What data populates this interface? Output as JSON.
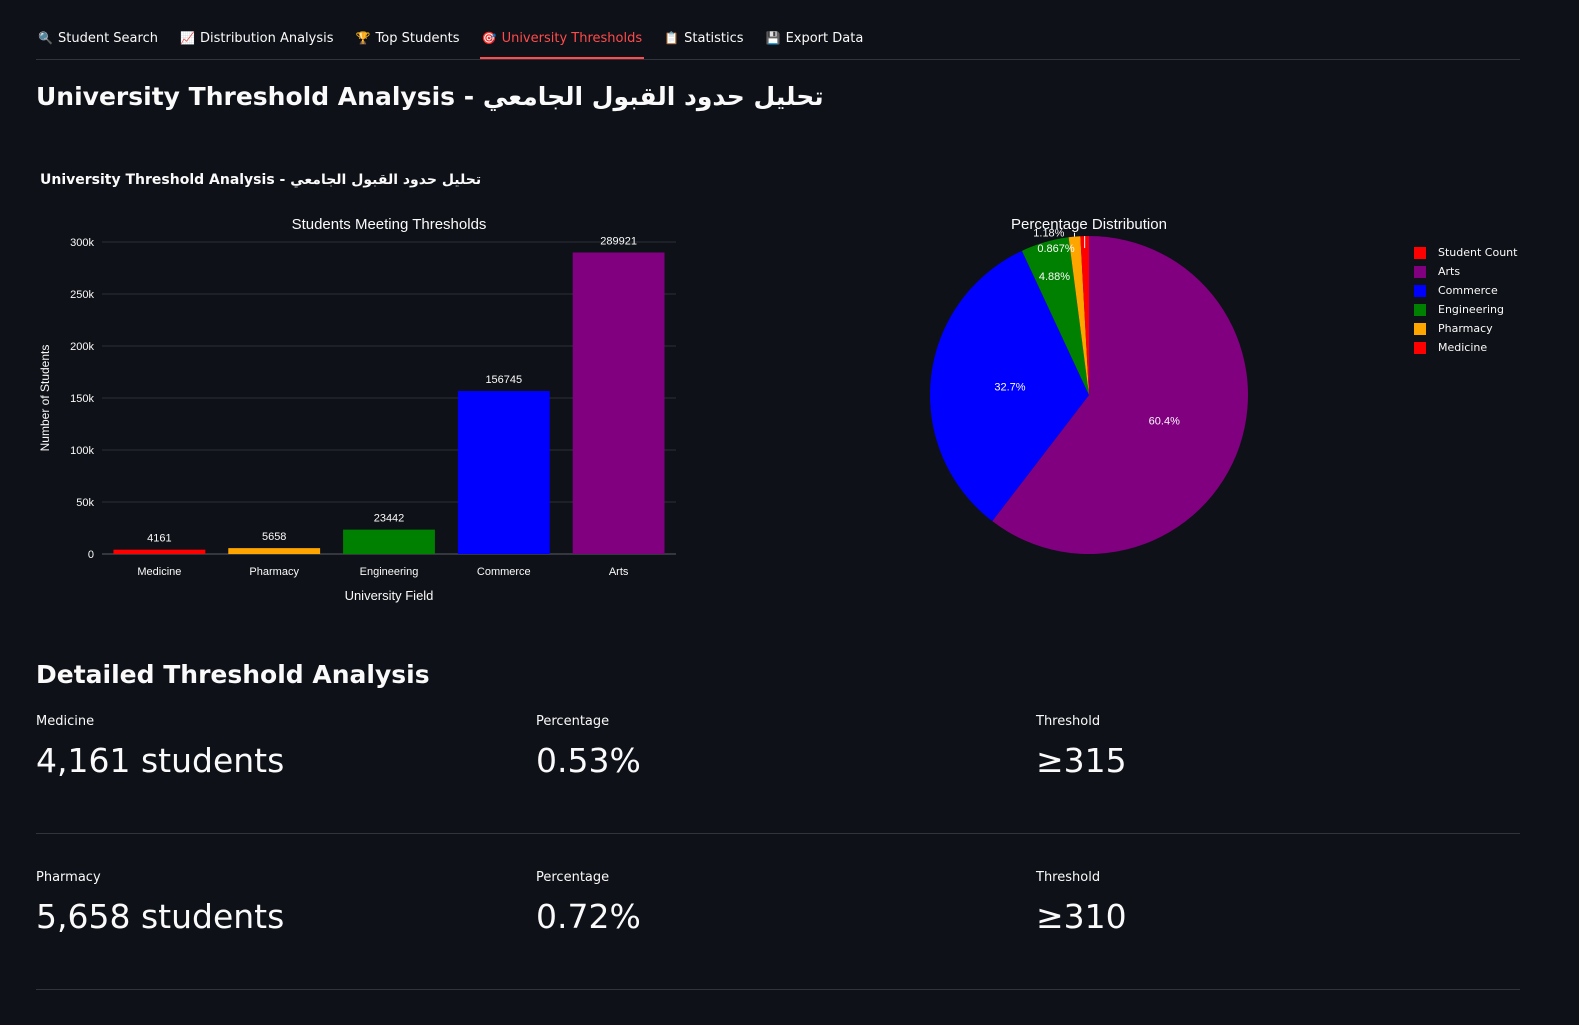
{
  "tabs": [
    {
      "icon": "🔍",
      "label": "Student Search"
    },
    {
      "icon": "📈",
      "label": "Distribution Analysis"
    },
    {
      "icon": "🏆",
      "label": "Top Students"
    },
    {
      "icon": "🎯",
      "label": "University Thresholds"
    },
    {
      "icon": "📋",
      "label": "Statistics"
    },
    {
      "icon": "💾",
      "label": "Export Data"
    }
  ],
  "page_title": "University Threshold Analysis - تحليل حدود القبول الجامعي",
  "figure_title": "University Threshold Analysis - تحليل حدود القبول الجامعي",
  "chart_data": [
    {
      "type": "bar",
      "title": "Students Meeting Thresholds",
      "xlabel": "University Field",
      "ylabel": "Number of Students",
      "categories": [
        "Medicine",
        "Pharmacy",
        "Engineering",
        "Commerce",
        "Arts"
      ],
      "values": [
        4161,
        5658,
        23442,
        156745,
        289921
      ],
      "colors": [
        "#ff0000",
        "#ffa500",
        "#008000",
        "#0000ff",
        "#800080"
      ],
      "ylim": [
        0,
        300000
      ],
      "yticks": [
        0,
        50000,
        100000,
        150000,
        200000,
        250000,
        300000
      ],
      "ytick_labels": [
        "0",
        "50k",
        "100k",
        "150k",
        "200k",
        "250k",
        "300k"
      ],
      "grid": true
    },
    {
      "type": "pie",
      "title": "Percentage Distribution",
      "labels": [
        "Arts",
        "Commerce",
        "Engineering",
        "Pharmacy",
        "Medicine"
      ],
      "values": [
        289921,
        156745,
        23442,
        5658,
        4161
      ],
      "percent_labels": [
        "60.4%",
        "32.7%",
        "4.88%",
        "1.18%",
        "0.867%"
      ],
      "colors": [
        "#800080",
        "#0000ff",
        "#008000",
        "#ffa500",
        "#ff0000"
      ],
      "legend_position": "top-right"
    }
  ],
  "legend": [
    {
      "label": "Student Count",
      "color": "#ff0000"
    },
    {
      "label": "Arts",
      "color": "#800080"
    },
    {
      "label": "Commerce",
      "color": "#0000ff"
    },
    {
      "label": "Engineering",
      "color": "#008000"
    },
    {
      "label": "Pharmacy",
      "color": "#ffa500"
    },
    {
      "label": "Medicine",
      "color": "#ff0000"
    }
  ],
  "section_title": "Detailed Threshold Analysis",
  "metrics": [
    {
      "field_label": "Medicine",
      "field_value": "4,161 students",
      "pct_label": "Percentage",
      "pct_value": "0.53%",
      "thr_label": "Threshold",
      "thr_value": "≥315"
    },
    {
      "field_label": "Pharmacy",
      "field_value": "5,658 students",
      "pct_label": "Percentage",
      "pct_value": "0.72%",
      "thr_label": "Threshold",
      "thr_value": "≥310"
    }
  ]
}
